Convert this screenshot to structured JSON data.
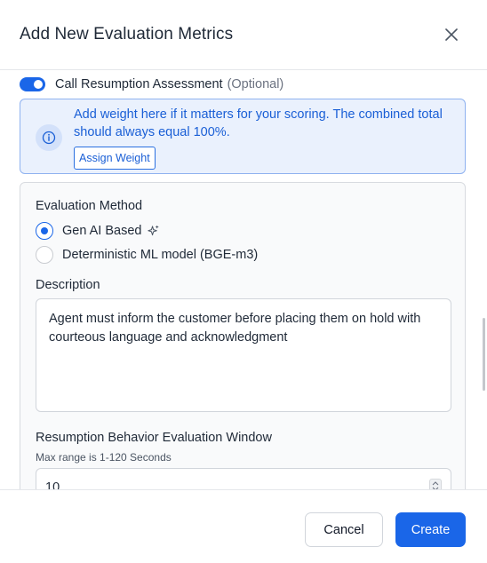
{
  "dialog": {
    "title": "Add New Evaluation Metrics"
  },
  "metric": {
    "name": "Call Resumption Assessment",
    "optional_label": "(Optional)",
    "enabled": true
  },
  "info_banner": {
    "message": "Add weight here if it matters for your scoring. The combined total should always equal 100%.",
    "assign_weight_label": "Assign Weight"
  },
  "evaluation_method": {
    "label": "Evaluation Method",
    "options": [
      {
        "label": "Gen AI Based",
        "selected": true,
        "icon": "sparkle-icon"
      },
      {
        "label": "Deterministic ML model (BGE-m3)",
        "selected": false
      }
    ]
  },
  "description": {
    "label": "Description",
    "value": "Agent must inform the customer before placing them on hold with courteous language and acknowledgment"
  },
  "resumption_window": {
    "label": "Resumption Behavior Evaluation Window",
    "helper": "Max range is 1-120 Seconds",
    "value": "10"
  },
  "footer": {
    "cancel_label": "Cancel",
    "create_label": "Create"
  },
  "colors": {
    "primary": "#1a66e8",
    "info_bg": "#eaf1fd",
    "info_border": "#8fb2f0",
    "info_text": "#1a5fd6"
  }
}
